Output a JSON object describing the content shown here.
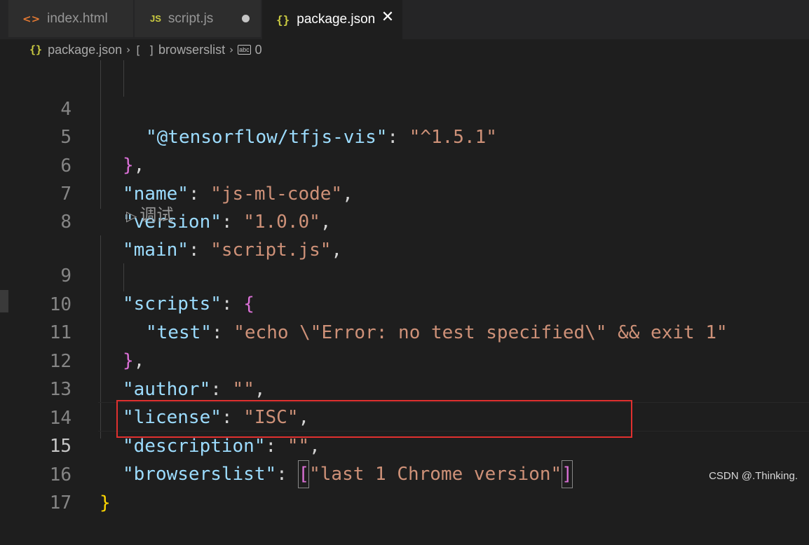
{
  "tabs": [
    {
      "label": "index.html",
      "icon": "<>",
      "icon_name": "html-file-icon"
    },
    {
      "label": "script.js",
      "icon": "JS",
      "icon_name": "js-file-icon",
      "dirty": true
    },
    {
      "label": "package.json",
      "icon": "{}",
      "icon_name": "json-file-icon",
      "active": true
    }
  ],
  "breadcrumb": {
    "file_icon": "{}",
    "file": "package.json",
    "array_icon": "[ ]",
    "node": "browserslist",
    "string_icon": "abc",
    "index": "0"
  },
  "codelens": {
    "label": "调试"
  },
  "lines": {
    "l4": {
      "num": "4",
      "key": "\"@tensorflow/tfjs-vis\"",
      "colon": ": ",
      "value": "\"^1.5.1\""
    },
    "l5": {
      "num": "5",
      "brace": "}",
      "comma": ","
    },
    "l6": {
      "num": "6",
      "key": "\"name\"",
      "colon": ": ",
      "value": "\"js-ml-code\"",
      "comma": ","
    },
    "l7": {
      "num": "7",
      "key": "\"version\"",
      "colon": ": ",
      "value": "\"1.0.0\"",
      "comma": ","
    },
    "l8": {
      "num": "8",
      "key": "\"main\"",
      "colon": ": ",
      "value": "\"script.js\"",
      "comma": ","
    },
    "l9": {
      "num": "9",
      "key": "\"scripts\"",
      "colon": ": ",
      "brace": "{"
    },
    "l10": {
      "num": "10",
      "key": "\"test\"",
      "colon": ": ",
      "value": "\"echo \\\"Error: no test specified\\\" && exit 1\""
    },
    "l11": {
      "num": "11",
      "brace": "}",
      "comma": ","
    },
    "l12": {
      "num": "12",
      "key": "\"author\"",
      "colon": ": ",
      "value": "\"\"",
      "comma": ","
    },
    "l13": {
      "num": "13",
      "key": "\"license\"",
      "colon": ": ",
      "value": "\"ISC\"",
      "comma": ","
    },
    "l14": {
      "num": "14",
      "key": "\"description\"",
      "colon": ": ",
      "value": "\"\"",
      "comma": ","
    },
    "l15": {
      "num": "15",
      "key": "\"browserslist\"",
      "colon": ": ",
      "open": "[",
      "value": "\"last 1 Chrome version\"",
      "close": "]"
    },
    "l16": {
      "num": "16",
      "brace": "}"
    },
    "l17": {
      "num": "17"
    }
  },
  "watermark": "CSDN @.Thinking.",
  "colors": {
    "key": "#9cdcfe",
    "string": "#ce9178",
    "bracket_level1": "#ffd700",
    "bracket_level2": "#da70d6",
    "highlight_border": "#e0302f",
    "background": "#1e1e1e"
  }
}
